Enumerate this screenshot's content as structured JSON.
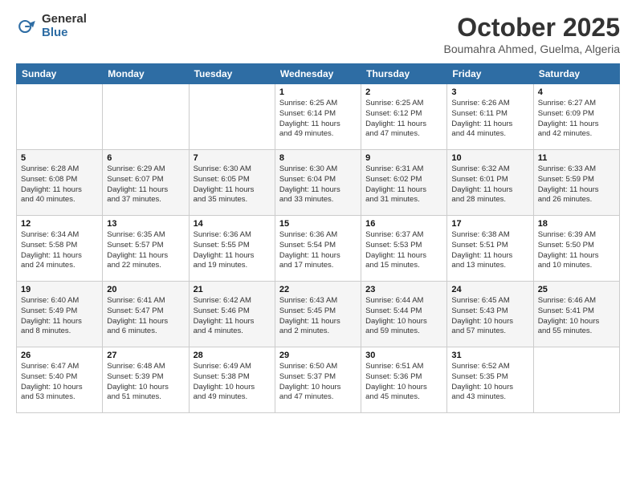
{
  "logo": {
    "general": "General",
    "blue": "Blue"
  },
  "header": {
    "month": "October 2025",
    "location": "Boumahra Ahmed, Guelma, Algeria"
  },
  "weekdays": [
    "Sunday",
    "Monday",
    "Tuesday",
    "Wednesday",
    "Thursday",
    "Friday",
    "Saturday"
  ],
  "weeks": [
    [
      {
        "day": "",
        "info": ""
      },
      {
        "day": "",
        "info": ""
      },
      {
        "day": "",
        "info": ""
      },
      {
        "day": "1",
        "info": "Sunrise: 6:25 AM\nSunset: 6:14 PM\nDaylight: 11 hours\nand 49 minutes."
      },
      {
        "day": "2",
        "info": "Sunrise: 6:25 AM\nSunset: 6:12 PM\nDaylight: 11 hours\nand 47 minutes."
      },
      {
        "day": "3",
        "info": "Sunrise: 6:26 AM\nSunset: 6:11 PM\nDaylight: 11 hours\nand 44 minutes."
      },
      {
        "day": "4",
        "info": "Sunrise: 6:27 AM\nSunset: 6:09 PM\nDaylight: 11 hours\nand 42 minutes."
      }
    ],
    [
      {
        "day": "5",
        "info": "Sunrise: 6:28 AM\nSunset: 6:08 PM\nDaylight: 11 hours\nand 40 minutes."
      },
      {
        "day": "6",
        "info": "Sunrise: 6:29 AM\nSunset: 6:07 PM\nDaylight: 11 hours\nand 37 minutes."
      },
      {
        "day": "7",
        "info": "Sunrise: 6:30 AM\nSunset: 6:05 PM\nDaylight: 11 hours\nand 35 minutes."
      },
      {
        "day": "8",
        "info": "Sunrise: 6:30 AM\nSunset: 6:04 PM\nDaylight: 11 hours\nand 33 minutes."
      },
      {
        "day": "9",
        "info": "Sunrise: 6:31 AM\nSunset: 6:02 PM\nDaylight: 11 hours\nand 31 minutes."
      },
      {
        "day": "10",
        "info": "Sunrise: 6:32 AM\nSunset: 6:01 PM\nDaylight: 11 hours\nand 28 minutes."
      },
      {
        "day": "11",
        "info": "Sunrise: 6:33 AM\nSunset: 5:59 PM\nDaylight: 11 hours\nand 26 minutes."
      }
    ],
    [
      {
        "day": "12",
        "info": "Sunrise: 6:34 AM\nSunset: 5:58 PM\nDaylight: 11 hours\nand 24 minutes."
      },
      {
        "day": "13",
        "info": "Sunrise: 6:35 AM\nSunset: 5:57 PM\nDaylight: 11 hours\nand 22 minutes."
      },
      {
        "day": "14",
        "info": "Sunrise: 6:36 AM\nSunset: 5:55 PM\nDaylight: 11 hours\nand 19 minutes."
      },
      {
        "day": "15",
        "info": "Sunrise: 6:36 AM\nSunset: 5:54 PM\nDaylight: 11 hours\nand 17 minutes."
      },
      {
        "day": "16",
        "info": "Sunrise: 6:37 AM\nSunset: 5:53 PM\nDaylight: 11 hours\nand 15 minutes."
      },
      {
        "day": "17",
        "info": "Sunrise: 6:38 AM\nSunset: 5:51 PM\nDaylight: 11 hours\nand 13 minutes."
      },
      {
        "day": "18",
        "info": "Sunrise: 6:39 AM\nSunset: 5:50 PM\nDaylight: 11 hours\nand 10 minutes."
      }
    ],
    [
      {
        "day": "19",
        "info": "Sunrise: 6:40 AM\nSunset: 5:49 PM\nDaylight: 11 hours\nand 8 minutes."
      },
      {
        "day": "20",
        "info": "Sunrise: 6:41 AM\nSunset: 5:47 PM\nDaylight: 11 hours\nand 6 minutes."
      },
      {
        "day": "21",
        "info": "Sunrise: 6:42 AM\nSunset: 5:46 PM\nDaylight: 11 hours\nand 4 minutes."
      },
      {
        "day": "22",
        "info": "Sunrise: 6:43 AM\nSunset: 5:45 PM\nDaylight: 11 hours\nand 2 minutes."
      },
      {
        "day": "23",
        "info": "Sunrise: 6:44 AM\nSunset: 5:44 PM\nDaylight: 10 hours\nand 59 minutes."
      },
      {
        "day": "24",
        "info": "Sunrise: 6:45 AM\nSunset: 5:43 PM\nDaylight: 10 hours\nand 57 minutes."
      },
      {
        "day": "25",
        "info": "Sunrise: 6:46 AM\nSunset: 5:41 PM\nDaylight: 10 hours\nand 55 minutes."
      }
    ],
    [
      {
        "day": "26",
        "info": "Sunrise: 6:47 AM\nSunset: 5:40 PM\nDaylight: 10 hours\nand 53 minutes."
      },
      {
        "day": "27",
        "info": "Sunrise: 6:48 AM\nSunset: 5:39 PM\nDaylight: 10 hours\nand 51 minutes."
      },
      {
        "day": "28",
        "info": "Sunrise: 6:49 AM\nSunset: 5:38 PM\nDaylight: 10 hours\nand 49 minutes."
      },
      {
        "day": "29",
        "info": "Sunrise: 6:50 AM\nSunset: 5:37 PM\nDaylight: 10 hours\nand 47 minutes."
      },
      {
        "day": "30",
        "info": "Sunrise: 6:51 AM\nSunset: 5:36 PM\nDaylight: 10 hours\nand 45 minutes."
      },
      {
        "day": "31",
        "info": "Sunrise: 6:52 AM\nSunset: 5:35 PM\nDaylight: 10 hours\nand 43 minutes."
      },
      {
        "day": "",
        "info": ""
      }
    ]
  ]
}
